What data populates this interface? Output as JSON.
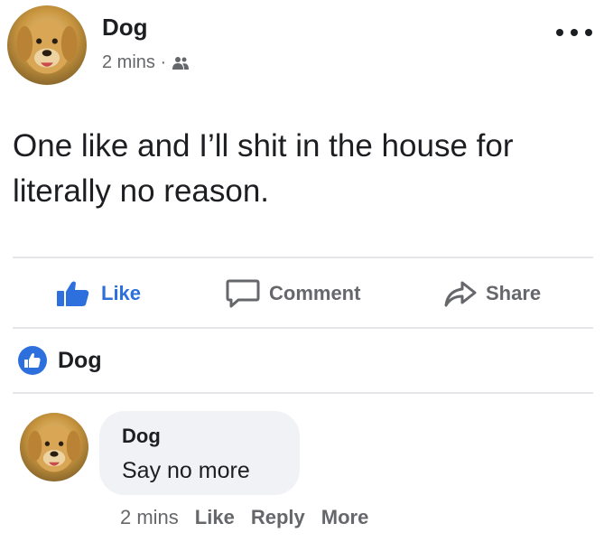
{
  "post": {
    "author": "Dog",
    "time": "2 mins ·",
    "audience_icon": "friends-icon",
    "text": "One like and I’ll shit in the house for literally no reason."
  },
  "actions": {
    "like": "Like",
    "comment": "Comment",
    "share": "Share"
  },
  "reactions": {
    "name": "Dog"
  },
  "comment": {
    "author": "Dog",
    "text": "Say no more",
    "time": "2 mins",
    "like": "Like",
    "reply": "Reply",
    "more": "More"
  },
  "colors": {
    "accent": "#2d6fdc",
    "muted": "#65676b",
    "bubble": "#f0f2f5"
  }
}
